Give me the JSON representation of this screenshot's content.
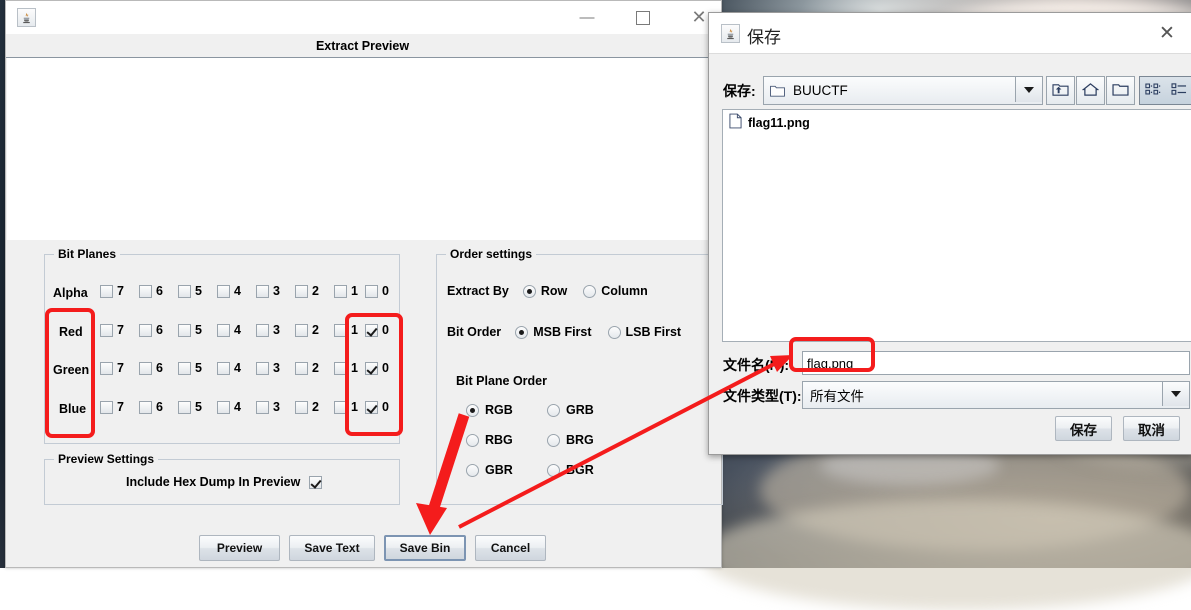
{
  "desktop": {
    "wallpaper_desc": "earth-from-space-dark-clouds"
  },
  "main_window": {
    "app_icon": "java-coffee-icon",
    "controls": {
      "minimize": "—",
      "maximize": "☐",
      "close": "✕"
    },
    "header_title": "Extract Preview",
    "bit_planes": {
      "legend": "Bit Planes",
      "bits": [
        "7",
        "6",
        "5",
        "4",
        "3",
        "2",
        "1",
        "0"
      ],
      "rows": [
        {
          "label": "Alpha",
          "checked": [
            false,
            false,
            false,
            false,
            false,
            false,
            false,
            false
          ]
        },
        {
          "label": "Red",
          "checked": [
            false,
            false,
            false,
            false,
            false,
            false,
            false,
            true
          ]
        },
        {
          "label": "Green",
          "checked": [
            false,
            false,
            false,
            false,
            false,
            false,
            false,
            true
          ]
        },
        {
          "label": "Blue",
          "checked": [
            false,
            false,
            false,
            false,
            false,
            false,
            false,
            true
          ]
        }
      ]
    },
    "preview_settings": {
      "legend": "Preview Settings",
      "hex_dump_label": "Include Hex Dump In Preview",
      "hex_dump_checked": true
    },
    "order_settings": {
      "legend": "Order settings",
      "extract_by_label": "Extract By",
      "extract_by_options": [
        "Row",
        "Column"
      ],
      "extract_by_selected": "Row",
      "bit_order_label": "Bit Order",
      "bit_order_options": [
        "MSB First",
        "LSB First"
      ],
      "bit_order_selected": "MSB First",
      "bit_plane_order_label": "Bit Plane Order",
      "bit_plane_order_options": [
        "RGB",
        "GRB",
        "RBG",
        "BRG",
        "GBR",
        "BGR"
      ],
      "bit_plane_order_selected": "RGB"
    },
    "buttons": {
      "preview": "Preview",
      "save_text": "Save Text",
      "save_bin": "Save Bin",
      "cancel": "Cancel"
    }
  },
  "save_dialog": {
    "app_icon": "java-coffee-icon",
    "title": "保存",
    "close": "✕",
    "save_in_label": "保存:",
    "save_in_value": "BUUCTF",
    "save_in_icon": "folder-icon",
    "dropdown_icon": "chevron-down-icon",
    "toolbar_icons": [
      "up-folder-icon",
      "home-icon",
      "new-folder-icon",
      "grid-view-icon",
      "list-view-icon"
    ],
    "toolbar_selected": "grid-view-icon",
    "file_list": [
      {
        "name": "flag11.png",
        "icon": "file-icon"
      }
    ],
    "filename_label": "文件名(N):",
    "filename_value": "flag.png",
    "filetype_label": "文件类型(T):",
    "filetype_value": "所有文件",
    "save_button": "保存",
    "cancel_button": "取消"
  },
  "annotations": {
    "highlight_color": "#f41c1c",
    "boxes": [
      {
        "name": "channel-labels-highlight"
      },
      {
        "name": "bit0-column-highlight"
      },
      {
        "name": "filename-field-highlight"
      }
    ],
    "arrows": [
      {
        "name": "arrow-rgb-to-save-bin"
      },
      {
        "name": "arrow-save-bin-to-filename"
      }
    ]
  }
}
